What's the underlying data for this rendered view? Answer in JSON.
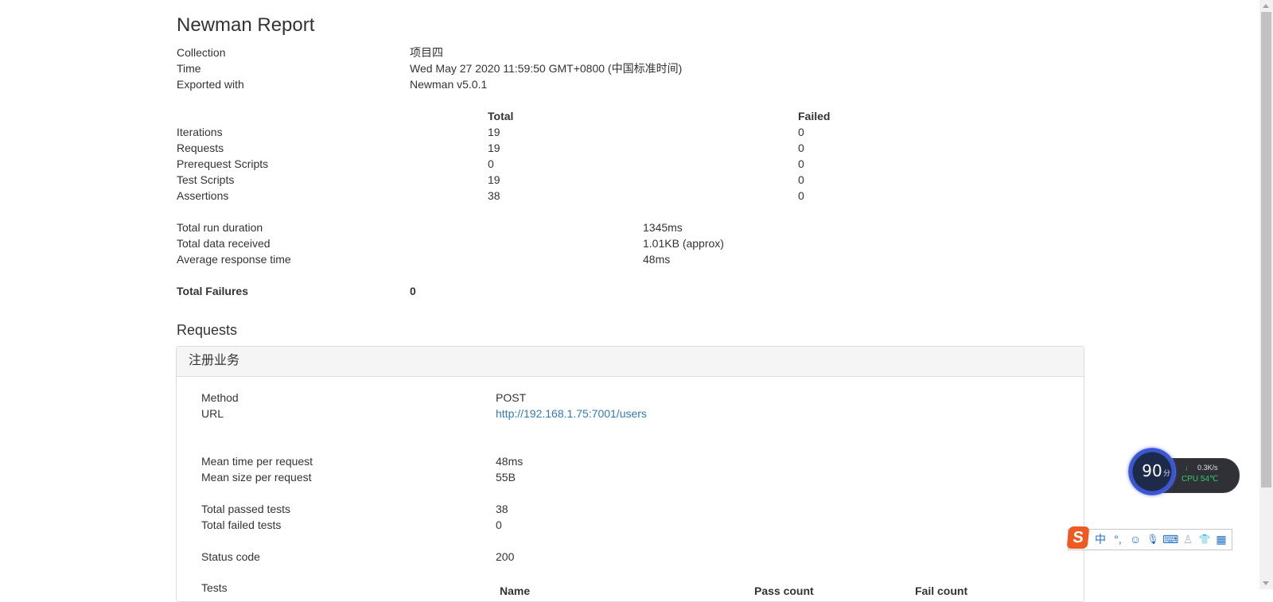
{
  "report": {
    "title": "Newman Report",
    "meta": [
      {
        "label": "Collection",
        "value": "项目四"
      },
      {
        "label": "Time",
        "value": "Wed May 27 2020 11:59:50 GMT+0800 (中国标准时间)"
      },
      {
        "label": "Exported with",
        "value": "Newman v5.0.1"
      }
    ],
    "stats_headers": {
      "total": "Total",
      "failed": "Failed"
    },
    "stats": [
      {
        "label": "Iterations",
        "total": "19",
        "failed": "0"
      },
      {
        "label": "Requests",
        "total": "19",
        "failed": "0"
      },
      {
        "label": "Prerequest Scripts",
        "total": "0",
        "failed": "0"
      },
      {
        "label": "Test Scripts",
        "total": "19",
        "failed": "0"
      },
      {
        "label": "Assertions",
        "total": "38",
        "failed": "0"
      }
    ],
    "timings": [
      {
        "label": "Total run duration",
        "value": "1345ms"
      },
      {
        "label": "Total data received",
        "value": "1.01KB (approx)"
      },
      {
        "label": "Average response time",
        "value": "48ms"
      }
    ],
    "total_failures": {
      "label": "Total Failures",
      "value": "0"
    }
  },
  "requests": {
    "heading": "Requests",
    "panel": {
      "title": "注册业务",
      "method": {
        "label": "Method",
        "value": "POST"
      },
      "url": {
        "label": "URL",
        "value": "http://192.168.1.75:7001/users"
      },
      "mean_time": {
        "label": "Mean time per request",
        "value": "48ms"
      },
      "mean_size": {
        "label": "Mean size per request",
        "value": "55B"
      },
      "passed": {
        "label": "Total passed tests",
        "value": "38"
      },
      "failed": {
        "label": "Total failed tests",
        "value": "0"
      },
      "status": {
        "label": "Status code",
        "value": "200"
      },
      "tests_label": "Tests",
      "tests_headers": [
        "Name",
        "Pass count",
        "Fail count"
      ]
    }
  },
  "speed_widget": {
    "score": "90",
    "score_unit": "分",
    "download": "0.3K/s",
    "download_arrow": "↓",
    "cpu": "CPU 54℃"
  },
  "ime_toolbar": {
    "logo": "S",
    "items": [
      {
        "name": "chinese-mode-icon",
        "glyph": "中",
        "grey": false
      },
      {
        "name": "punctuation-icon",
        "glyph": "°,",
        "grey": false
      },
      {
        "name": "emoji-icon",
        "glyph": "☺",
        "grey": false
      },
      {
        "name": "microphone-icon",
        "glyph": "🎙",
        "grey": false
      },
      {
        "name": "keyboard-icon",
        "glyph": "⌨",
        "grey": false
      },
      {
        "name": "user-icon",
        "glyph": "♙",
        "grey": true
      },
      {
        "name": "skin-shirt-icon",
        "glyph": "👕",
        "grey": false
      },
      {
        "name": "toolbox-grid-icon",
        "glyph": "▦",
        "grey": false
      }
    ]
  }
}
